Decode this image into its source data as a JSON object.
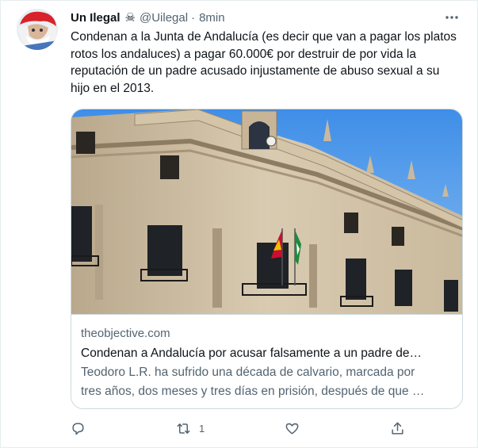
{
  "tweet": {
    "display_name": "Un Ilegal",
    "handle": "@Uilegal",
    "separator": "·",
    "time": "8min",
    "text": "Condenan a la Junta de Andalucía (es decir que van a pagar los platos rotos los andaluces) a pagar 60.000€ por destruir de por vida la reputación de un padre acusado injustamente de abuso sexual a su hijo en el 2013."
  },
  "card": {
    "domain": "theobjective.com",
    "title": "Condenan a Andalucía por acusar falsamente a un padre de…",
    "description": "Teodoro L.R. ha sufrido una década de calvario, marcada por\ntres años, dos meses y tres días en prisión, después de que …"
  },
  "actions": {
    "reply_count": "",
    "retweet_count": "1",
    "like_count": ""
  },
  "icons": {
    "name_badge": "skull-and-crossbones-icon",
    "more": "more-horizontal-icon",
    "reply": "reply-icon",
    "retweet": "retweet-icon",
    "like": "heart-icon",
    "share": "share-icon"
  },
  "colors": {
    "text_primary": "#0f1419",
    "text_secondary": "#536471",
    "border": "#cfd9de"
  }
}
